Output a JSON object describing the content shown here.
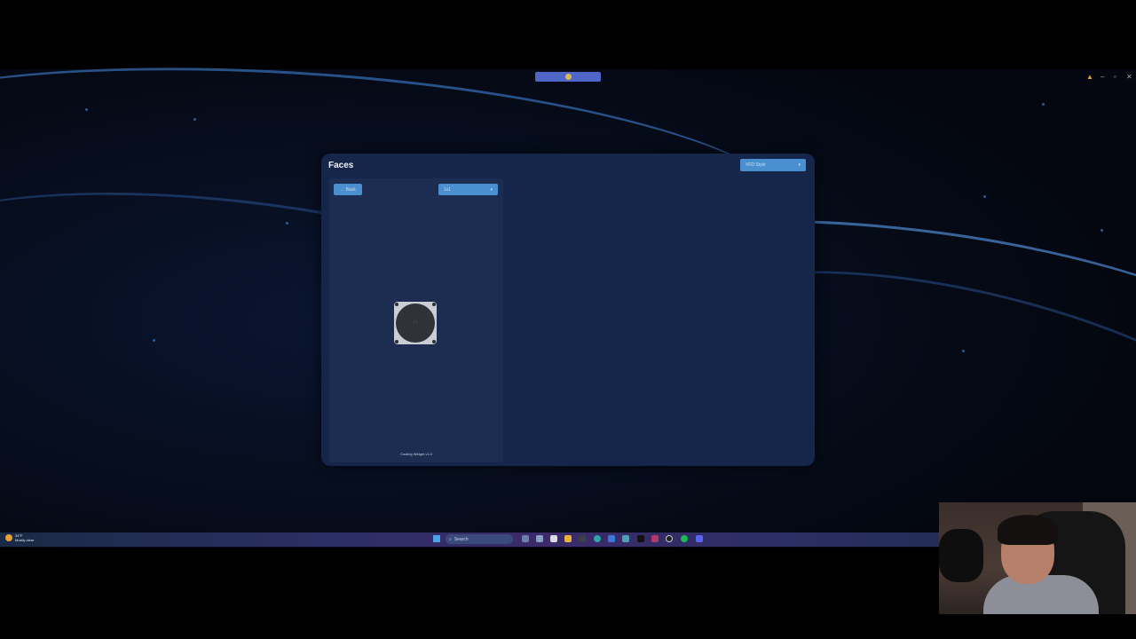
{
  "app": {
    "title": "Faces",
    "style_select": "VFD Style",
    "back_button": "← Back",
    "size_select": "1x1",
    "widget_face_text": "H",
    "version": "Cooling Widget v1.0"
  },
  "taskbar": {
    "weather_temp": "34°F",
    "weather_desc": "Mostly clear",
    "search_placeholder": "Search"
  },
  "colors": {
    "accent": "#4a8fd0",
    "panel": "#1d2d52",
    "window": "#15264a",
    "top_pill": "#4f66c8"
  },
  "icons": [
    "windows-start-icon",
    "search-icon",
    "file-explorer-icon",
    "edge-icon",
    "store-icon",
    "terminal-icon",
    "chrome-icon",
    "spotify-icon",
    "discord-icon",
    "tiktok-icon"
  ]
}
